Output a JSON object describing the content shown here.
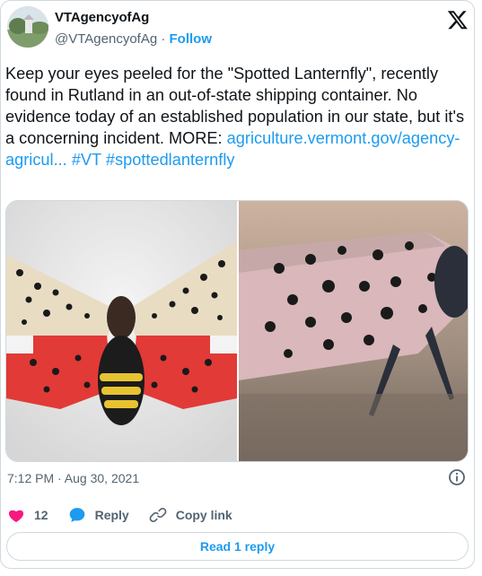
{
  "author": {
    "display_name": "VTAgencyofAg",
    "handle": "@VTAgencyofAg",
    "separator": " · ",
    "follow_label": "Follow"
  },
  "tweet": {
    "text": "Keep your eyes peeled for the \"Spotted Lanternfly\", recently found in Rutland in an out-of-state shipping container.  No evidence today of an established population in our state, but it's a concerning incident. MORE: ",
    "link": "agriculture.vermont.gov/agency-agricul...",
    "hashtag_vt": "#VT",
    "hashtag_spotted": "#spottedlanternfly",
    "timestamp": "7:12 PM · Aug 30, 2021"
  },
  "actions": {
    "like_count": "12",
    "reply_label": "Reply",
    "copy_label": "Copy link"
  },
  "read_replies_label": "Read 1 reply",
  "colors": {
    "accent": "#1d9bf0",
    "like": "#f91880",
    "text": "#0f1419",
    "secondary": "#536471",
    "border": "#cfd9de"
  },
  "icons": [
    "x-logo-icon",
    "info-icon",
    "heart-icon",
    "reply-bubble-icon",
    "link-icon"
  ]
}
